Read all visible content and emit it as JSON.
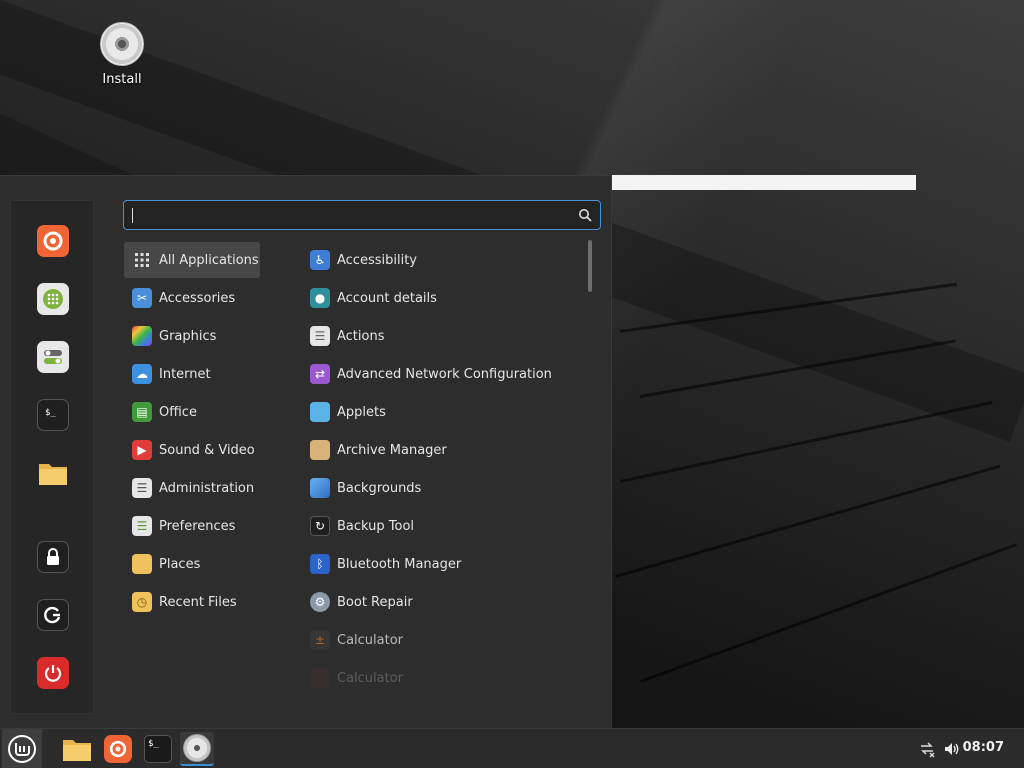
{
  "desktop": {
    "icons": [
      {
        "label": "Install",
        "icon": "disc-icon"
      }
    ]
  },
  "search": {
    "value": "",
    "placeholder": "",
    "icon": "search-icon"
  },
  "favorites": [
    {
      "name": "firefox",
      "icon": "firefox-icon"
    },
    {
      "name": "software-manager",
      "icon": "software-manager-icon"
    },
    {
      "name": "system-settings",
      "icon": "toggles-icon"
    },
    {
      "name": "terminal",
      "icon": "terminal-icon"
    },
    {
      "name": "files",
      "icon": "folder-icon"
    },
    {
      "name": "lock-screen",
      "icon": "lock-icon"
    },
    {
      "name": "logout",
      "icon": "logout-icon"
    },
    {
      "name": "shutdown",
      "icon": "power-icon"
    }
  ],
  "categories": [
    {
      "label": "All Applications",
      "icon": "grid-icon",
      "selected": true
    },
    {
      "label": "Accessories",
      "icon": "scissors-icon"
    },
    {
      "label": "Graphics",
      "icon": "palette-icon"
    },
    {
      "label": "Internet",
      "icon": "cloud-icon"
    },
    {
      "label": "Office",
      "icon": "office-icon"
    },
    {
      "label": "Sound & Video",
      "icon": "play-icon"
    },
    {
      "label": "Administration",
      "icon": "admin-icon"
    },
    {
      "label": "Preferences",
      "icon": "preferences-icon"
    },
    {
      "label": "Places",
      "icon": "folder-icon"
    },
    {
      "label": "Recent Files",
      "icon": "recent-folder-icon"
    }
  ],
  "applications": [
    {
      "label": "Accessibility",
      "icon": "accessibility-icon"
    },
    {
      "label": "Account details",
      "icon": "account-icon"
    },
    {
      "label": "Actions",
      "icon": "actions-icon"
    },
    {
      "label": "Advanced Network Configuration",
      "icon": "network-icon"
    },
    {
      "label": "Applets",
      "icon": "applets-icon"
    },
    {
      "label": "Archive Manager",
      "icon": "archive-icon"
    },
    {
      "label": "Backgrounds",
      "icon": "backgrounds-icon"
    },
    {
      "label": "Backup Tool",
      "icon": "backup-icon"
    },
    {
      "label": "Bluetooth Manager",
      "icon": "bluetooth-icon"
    },
    {
      "label": "Boot Repair",
      "icon": "boot-repair-icon"
    },
    {
      "label": "Calculator",
      "icon": "calculator-icon"
    },
    {
      "label": "Calculator",
      "icon": "calculator-icon"
    }
  ],
  "taskbar": {
    "items": [
      {
        "name": "menu",
        "icon": "mint-logo-icon"
      },
      {
        "name": "files",
        "icon": "folder-icon"
      },
      {
        "name": "firefox",
        "icon": "firefox-icon"
      },
      {
        "name": "terminal",
        "icon": "terminal-icon"
      },
      {
        "name": "install",
        "icon": "disc-icon"
      }
    ],
    "tray": [
      {
        "name": "network",
        "icon": "network-disconnected-icon"
      },
      {
        "name": "volume",
        "icon": "volume-icon"
      }
    ],
    "clock": "08:07"
  },
  "colors": {
    "accent": "#4a90d9",
    "menu_bg": "#2d2d2d",
    "selected_bg": "#474747",
    "shutdown_red": "#d92b2b",
    "firefox_orange": "#ef6535"
  }
}
